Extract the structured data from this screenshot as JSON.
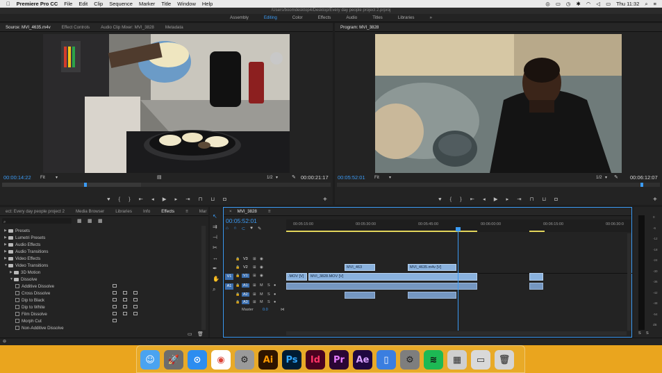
{
  "menubar": {
    "app_name": "Premiere Pro CC",
    "items": [
      "File",
      "Edit",
      "Clip",
      "Sequence",
      "Marker",
      "Title",
      "Window",
      "Help"
    ],
    "clock": "Thu 11:32"
  },
  "titlebar": {
    "path": "/Users/boomdesktop4/Desktop/Every day people project 2.prproj"
  },
  "workspaces": [
    "Assembly",
    "Editing",
    "Color",
    "Effects",
    "Audio",
    "Titles",
    "Libraries",
    "»"
  ],
  "source_panel": {
    "tabs": [
      "Source: MVI_4635.m4v",
      "Effect Controls",
      "Audio Clip Mixer: MVI_3828",
      "Metadata"
    ],
    "timecode_in": "00:00:14:22",
    "fit": "Fit",
    "resolution": "1/2",
    "duration": "00:00:21:17"
  },
  "program_panel": {
    "tabs": [
      "Program: MVI_3828"
    ],
    "timecode_in": "00:05:52:01",
    "fit": "Fit",
    "resolution": "1/2",
    "duration": "00:06:12:07"
  },
  "project_panel": {
    "tabs": [
      "ect: Every day people project 2",
      "Media Browser",
      "Libraries",
      "Info",
      "Effects",
      "Mar",
      "»"
    ],
    "tree": [
      {
        "label": "Presets",
        "level": 0,
        "kind": "folder",
        "open": false
      },
      {
        "label": "Lumetri Presets",
        "level": 0,
        "kind": "folder",
        "open": false
      },
      {
        "label": "Audio Effects",
        "level": 0,
        "kind": "folder",
        "open": false
      },
      {
        "label": "Audio Transitions",
        "level": 0,
        "kind": "folder",
        "open": false
      },
      {
        "label": "Video Effects",
        "level": 0,
        "kind": "folder",
        "open": false
      },
      {
        "label": "Video Transitions",
        "level": 0,
        "kind": "folder",
        "open": true
      },
      {
        "label": "3D Motion",
        "level": 1,
        "kind": "folder",
        "open": false
      },
      {
        "label": "Dissolve",
        "level": 1,
        "kind": "folder",
        "open": true
      },
      {
        "label": "Additive Dissolve",
        "level": 2,
        "kind": "fx",
        "badges": 1
      },
      {
        "label": "Cross Dissolve",
        "level": 2,
        "kind": "fx",
        "badges": 3
      },
      {
        "label": "Dip to Black",
        "level": 2,
        "kind": "fx",
        "badges": 3
      },
      {
        "label": "Dip to White",
        "level": 2,
        "kind": "fx",
        "badges": 3
      },
      {
        "label": "Film Dissolve",
        "level": 2,
        "kind": "fx",
        "badges": 3
      },
      {
        "label": "Morph Cut",
        "level": 2,
        "kind": "fx",
        "badges": 1
      },
      {
        "label": "Non-Additive Dissolve",
        "level": 2,
        "kind": "fx",
        "badges": 0
      }
    ]
  },
  "timeline": {
    "tab": "MVI_3828",
    "timecode": "00:05:52:01",
    "ruler": [
      "00:05:15:00",
      "00:05:30:00",
      "00:05:45:00",
      "00:06:00:00",
      "00:06:15:00",
      "00:06:30:0"
    ],
    "tracks": [
      "V3",
      "V2",
      "V1",
      "A1",
      "A2",
      "A3"
    ],
    "source_patch": {
      "v": "V1",
      "a": "A1"
    },
    "master": {
      "label": "Master",
      "value": "0.0"
    },
    "clips": {
      "v2a": "MVI_463",
      "v2b": "MVI_4635.m4v [V]",
      "v1a": ".MOV [V]",
      "v1b": "MVI_3828.MOV [V]"
    }
  },
  "meters": {
    "labels": [
      "0",
      "-6",
      "-12",
      "-18",
      "-24",
      "-30",
      "-36",
      "-42",
      "-48",
      "-54",
      "dB"
    ],
    "solo": [
      "S",
      "S"
    ]
  },
  "dock": {
    "apps": [
      {
        "name": "Finder",
        "glyph": "☺",
        "bg": "#4aa3f0",
        "fg": "#ffffff"
      },
      {
        "name": "Launchpad",
        "glyph": "🚀",
        "bg": "#6d6d6d",
        "fg": "#ffffff"
      },
      {
        "name": "Safari",
        "glyph": "⊙",
        "bg": "#2c8df0",
        "fg": "#ffffff"
      },
      {
        "name": "Chrome",
        "glyph": "◉",
        "bg": "#ffffff",
        "fg": "#db4437"
      },
      {
        "name": "Disk Utility",
        "glyph": "⚙",
        "bg": "#9a9a9a",
        "fg": "#222"
      },
      {
        "name": "Illustrator",
        "glyph": "Ai",
        "bg": "#2d1400",
        "fg": "#ff9a00"
      },
      {
        "name": "Photoshop",
        "glyph": "Ps",
        "bg": "#001c33",
        "fg": "#31a8ff"
      },
      {
        "name": "InDesign",
        "glyph": "Id",
        "bg": "#49021f",
        "fg": "#ff3366"
      },
      {
        "name": "Premiere",
        "glyph": "Pr",
        "bg": "#2a0634",
        "fg": "#e77bff"
      },
      {
        "name": "After Effects",
        "glyph": "Ae",
        "bg": "#1f0740",
        "fg": "#d8a1ff"
      },
      {
        "name": "Keynote",
        "glyph": "▯",
        "bg": "#3a7ee0",
        "fg": "#ffffff"
      },
      {
        "name": "System Preferences",
        "glyph": "⚙",
        "bg": "#7e7e7e",
        "fg": "#222"
      },
      {
        "name": "Spotify",
        "glyph": "≋",
        "bg": "#1db954",
        "fg": "#111"
      },
      {
        "name": "Photos Folder",
        "glyph": "▦",
        "bg": "#cfcfcf",
        "fg": "#333"
      },
      {
        "name": "Screenshot",
        "glyph": "▭",
        "bg": "#d9d9d9",
        "fg": "#333"
      },
      {
        "name": "Trash",
        "glyph": "🗑",
        "bg": "#d5d5d5",
        "fg": "#555"
      }
    ]
  },
  "colors": {
    "accent": "#3b9bf5",
    "clip_video": "#8ab2de",
    "clip_audio": "#7597c1",
    "dock_band": "#eaa51e"
  }
}
